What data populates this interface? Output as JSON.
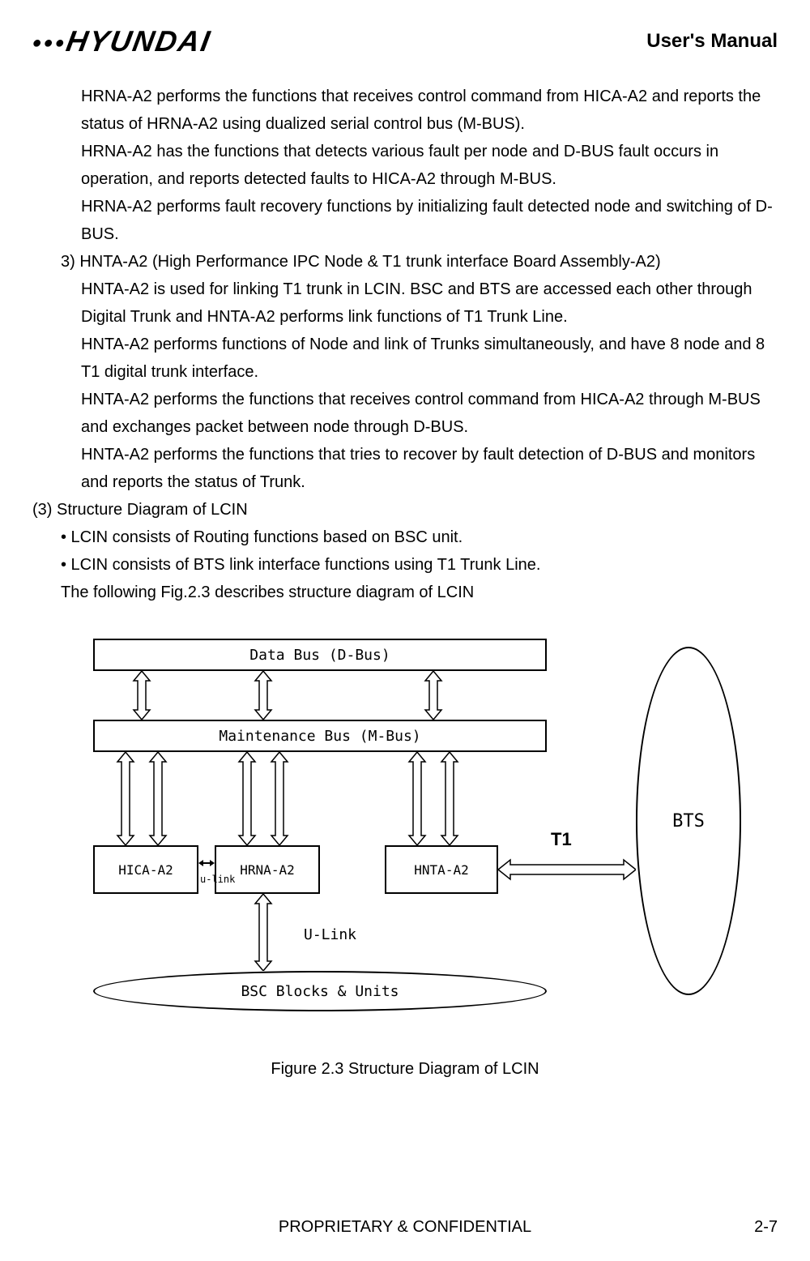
{
  "header": {
    "logo_text": "HYUNDAI",
    "manual_title": "User's Manual"
  },
  "body": {
    "p1": "HRNA-A2 performs the functions that receives control command from HICA-A2 and reports the status of HRNA-A2 using dualized serial control bus (M-BUS).",
    "p2": "HRNA-A2 has the functions that detects various fault per node and D-BUS fault occurs in operation, and reports detected faults to HICA-A2 through M-BUS.",
    "p3": "HRNA-A2 performs fault recovery functions by initializing fault detected node and switching of D-BUS.",
    "p4": "3) HNTA-A2 (High Performance IPC Node & T1 trunk interface Board Assembly-A2)",
    "p5": "HNTA-A2 is used for linking T1 trunk in LCIN. BSC and BTS are accessed each other through Digital Trunk and HNTA-A2 performs link functions of T1 Trunk Line.",
    "p6": "HNTA-A2 performs functions of Node and link of Trunks simultaneously, and have 8 node and 8 T1 digital trunk interface.",
    "p7": "HNTA-A2 performs the functions that receives control command from HICA-A2 through M-BUS and exchanges packet between node through D-BUS.",
    "p8": "HNTA-A2 performs the functions that tries to recover by fault detection of D-BUS and monitors and reports the status of Trunk.",
    "p9": "(3) Structure Diagram of LCIN",
    "p10": "• LCIN consists of Routing functions based on BSC unit.",
    "p11": "• LCIN consists of BTS link interface functions using T1 Trunk Line.",
    "p12": "The following Fig.2.3 describes structure diagram of LCIN"
  },
  "diagram": {
    "dbus": "Data Bus (D-Bus)",
    "mbus": "Maintenance Bus (M-Bus)",
    "hica": "HICA-A2",
    "hrna": "HRNA-A2",
    "hnta": "HNTA-A2",
    "bts": "BTS",
    "bsc": "BSC Blocks & Units",
    "ulink": "U-Link",
    "ulink_small": "u-link",
    "t1": "T1"
  },
  "figure_caption": "Figure 2.3 Structure Diagram of LCIN",
  "footer": {
    "center": "PROPRIETARY & CONFIDENTIAL",
    "page": "2-7"
  }
}
